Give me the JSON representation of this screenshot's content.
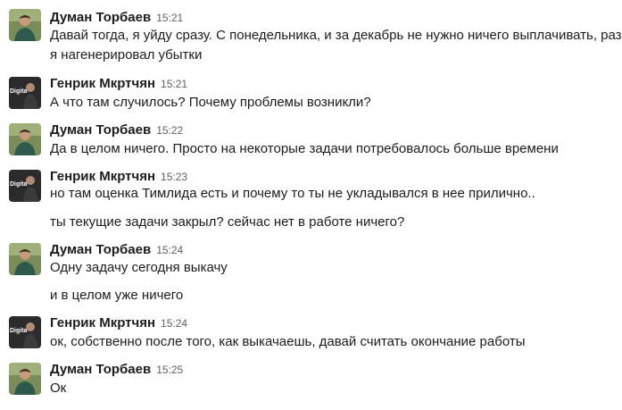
{
  "messages": [
    {
      "author": "Думан Торбаев",
      "time": "15:21",
      "lines": [
        "Давай тогда, я уйду сразу. С понедельника, и за декабрь не нужно ничего выплачивать, раз",
        "я нагенерировал убытки"
      ]
    },
    {
      "author": "Генрик Мкртчян",
      "time": "15:21",
      "lines": [
        "А что там случилось? Почему проблемы возникли?"
      ]
    },
    {
      "author": "Думан Торбаев",
      "time": "15:22",
      "lines": [
        "Да в целом ничего. Просто на некоторые задачи потребовалось больше времени"
      ]
    },
    {
      "author": "Генрик Мкртчян",
      "time": "15:23",
      "lines": [
        "но там оценка Тимлида есть и почему то ты не укладывался в нее прилично.."
      ]
    },
    {
      "lines": [
        "ты текущие задачи закрыл? сейчас нет в работе ничего?"
      ]
    },
    {
      "author": "Думан Торбаев",
      "time": "15:24",
      "lines": [
        "Одну задачу сегодня выкачу"
      ]
    },
    {
      "lines": [
        "и в целом уже ничего"
      ]
    },
    {
      "author": "Генрик Мкртчян",
      "time": "15:24",
      "lines": [
        "ок, собственно после того, как выкачаешь, давай считать окончание работы"
      ]
    },
    {
      "author": "Думан Торбаев",
      "time": "15:25",
      "lines": [
        "Ок"
      ]
    }
  ],
  "avatars": {
    "genrik_text": "Digita"
  }
}
